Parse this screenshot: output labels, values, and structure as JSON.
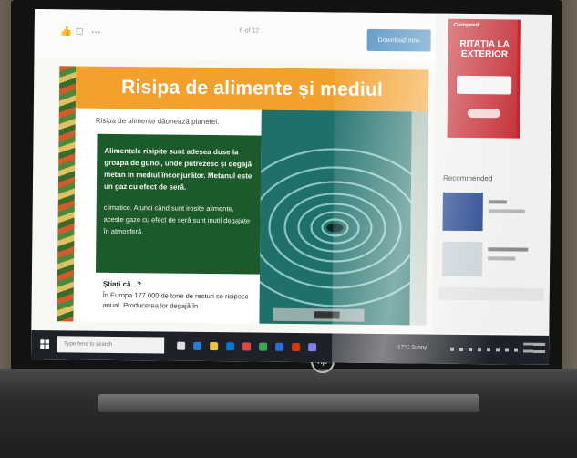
{
  "toolbar": {
    "page_count": "6 of 12",
    "primary_button": "Download now"
  },
  "slide": {
    "title": "Risipa de alimente și mediul",
    "subtitle": "Risipa de alimente dăunează planetei.",
    "green_p1": "Alimentele risipite sunt adesea duse la groapa de gunoi, unde putrezesc și degajă metan în mediul înconjurător. Metanul este un gaz cu efect de seră.",
    "green_p2": "climatice. Atunci când sunt irosite alimente, aceste gaze cu efect de seră sunt inutil degajate în atmosferă.",
    "stiati_heading": "Știați că...?",
    "stiati_body": "În Europa 177 000 de tone de resturi se risipesc anual. Producerea lor degajă în"
  },
  "ad": {
    "brand": "Compeed",
    "headline": "RITAȚIA LA EXTERIOR"
  },
  "sidebar": {
    "recommended_title": "Recommended"
  },
  "taskbar": {
    "search_placeholder": "Type here to search",
    "weather": "17°C Sunny"
  },
  "colors": {
    "title_band": "#f3a12d",
    "green_box": "#1d5a2b",
    "ad_red": "#c3262e",
    "taskbar": "#1e2128"
  }
}
